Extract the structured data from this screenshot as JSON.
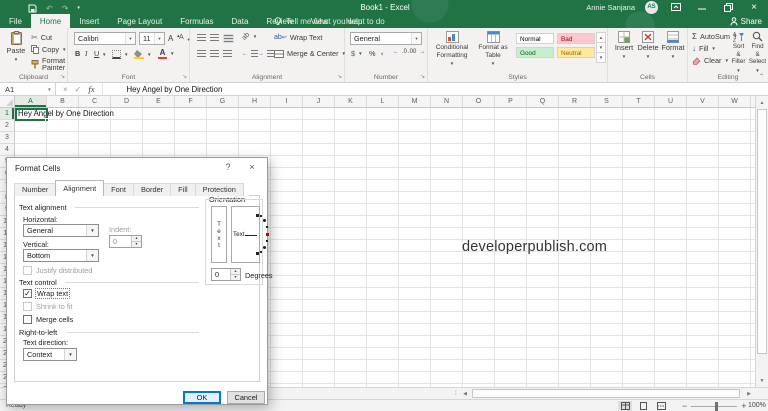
{
  "colors": {
    "excel_green": "#217346",
    "selection_border": "#217346",
    "ok_focus_border": "#0078d7",
    "style_bad_bg": "#ffc7ce",
    "style_bad_fg": "#9c0006",
    "style_good_bg": "#c6efce",
    "style_good_fg": "#006100",
    "style_neutral_bg": "#ffeb9c",
    "style_neutral_fg": "#9c6500",
    "style_normal_bg": "#ffffff",
    "style_normal_fg": "#000000"
  },
  "titlebar": {
    "title": "Book1 - Excel",
    "user_name": "Annie Sanjana",
    "user_initials": "AS"
  },
  "menu": {
    "tabs": [
      {
        "label": "File",
        "active": false
      },
      {
        "label": "Home",
        "active": true
      },
      {
        "label": "Insert",
        "active": false
      },
      {
        "label": "Page Layout",
        "active": false
      },
      {
        "label": "Formulas",
        "active": false
      },
      {
        "label": "Data",
        "active": false
      },
      {
        "label": "Review",
        "active": false
      },
      {
        "label": "View",
        "active": false
      },
      {
        "label": "Help",
        "active": false
      }
    ],
    "tell_me": "Tell me what you want to do",
    "share_label": "Share"
  },
  "ribbon": {
    "clipboard": {
      "group_label": "Clipboard",
      "paste_label": "Paste",
      "cut_label": "Cut",
      "copy_label": "Copy",
      "format_painter_label": "Format Painter"
    },
    "font": {
      "group_label": "Font",
      "font_name": "Calibri",
      "font_size": "11",
      "bold": "B",
      "italic": "I",
      "underline": "U"
    },
    "alignment": {
      "group_label": "Alignment",
      "wrap_text_label": "Wrap Text",
      "merge_center_label": "Merge & Center"
    },
    "number": {
      "group_label": "Number",
      "format_value": "General",
      "accounting": "$",
      "percent": "%",
      "comma": ",",
      "inc_decimal": ".0",
      "dec_decimal": ".00"
    },
    "styles": {
      "group_label": "Styles",
      "conditional_label": "Conditional Formatting",
      "format_table_label": "Format as Table",
      "gallery": [
        {
          "name": "Normal",
          "bg": "#ffffff",
          "fg": "#000000"
        },
        {
          "name": "Bad",
          "bg": "#ffc7ce",
          "fg": "#9c0006"
        },
        {
          "name": "Good",
          "bg": "#c6efce",
          "fg": "#006100"
        },
        {
          "name": "Neutral",
          "bg": "#ffeb9c",
          "fg": "#9c6500"
        }
      ]
    },
    "cells": {
      "group_label": "Cells",
      "insert_label": "Insert",
      "delete_label": "Delete",
      "format_label": "Format"
    },
    "editing": {
      "group_label": "Editing",
      "autosum_label": "AutoSum",
      "fill_label": "Fill",
      "clear_label": "Clear",
      "sort_label": "Sort & Filter",
      "find_label": "Find & Select"
    }
  },
  "formula_bar": {
    "name_box": "A1",
    "fx_label": "fx",
    "value": "Hey Angel by One Direction"
  },
  "grid": {
    "columns": [
      "A",
      "B",
      "C",
      "D",
      "E",
      "F",
      "G",
      "H",
      "I",
      "J",
      "K",
      "L",
      "M",
      "N",
      "O",
      "P",
      "Q",
      "R",
      "S",
      "T",
      "U",
      "V",
      "W"
    ],
    "row_count": 24,
    "selected_column": "A",
    "selected_row": 1,
    "a1_text": "Hey Angel by One Direction",
    "watermark": "developerpublish.com"
  },
  "dialog": {
    "title": "Format Cells",
    "help": "?",
    "close": "×",
    "tabs": [
      "Number",
      "Alignment",
      "Font",
      "Border",
      "Fill",
      "Protection"
    ],
    "active_tab": "Alignment",
    "text_alignment": {
      "legend": "Text alignment",
      "horizontal_label": "Horizontal:",
      "horizontal_value": "General",
      "indent_label": "Indent:",
      "indent_value": "0",
      "vertical_label": "Vertical:",
      "vertical_value": "Bottom",
      "justify_label": "Justify distributed"
    },
    "orientation": {
      "legend": "Orientation",
      "vertical_text": "Text",
      "needle_text": "Text",
      "degrees_value": "0",
      "degrees_label": "Degrees"
    },
    "text_control": {
      "legend": "Text control",
      "wrap_label": "Wrap text",
      "shrink_label": "Shrink to fit",
      "merge_label": "Merge cells"
    },
    "rtl": {
      "legend": "Right-to-left",
      "direction_label": "Text direction:",
      "direction_value": "Context"
    },
    "ok_label": "OK",
    "cancel_label": "Cancel"
  },
  "status": {
    "ready": "Ready",
    "zoom_level": "100%"
  }
}
